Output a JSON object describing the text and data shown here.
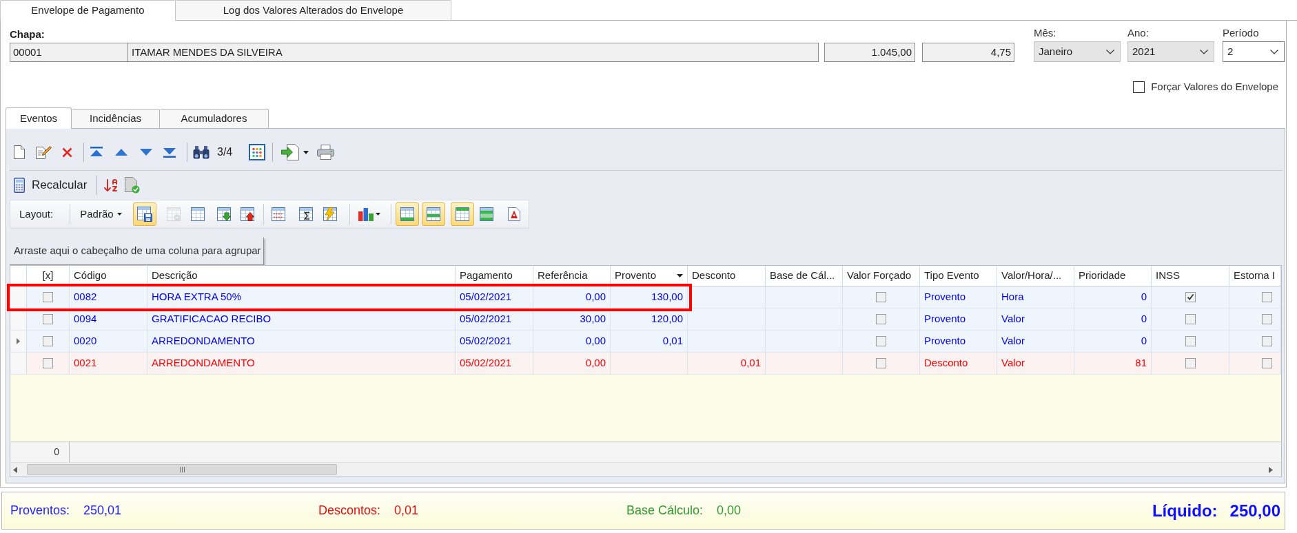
{
  "tabs": [
    {
      "label": "Envelope de Pagamento",
      "selected": true
    },
    {
      "label": "Log dos Valores Alterados do Envelope",
      "selected": false
    }
  ],
  "employee": {
    "label": "Chapa:",
    "chapa": "00001",
    "name": "ITAMAR MENDES DA SILVEIRA",
    "field_3": "1.045,00",
    "field_4": "4,75"
  },
  "selectors": [
    {
      "label": "Mês:",
      "value": "Janeiro",
      "editable": false
    },
    {
      "label": "Ano:",
      "value": "2021",
      "editable": false
    },
    {
      "label": "Período",
      "value": "2",
      "editable": true
    }
  ],
  "force_values": {
    "label": "Forçar Valores do Envelope",
    "checked": false
  },
  "detail_tabs": [
    {
      "label": "Eventos",
      "selected": true
    },
    {
      "label": "Incidências",
      "selected": false
    },
    {
      "label": "Acumuladores",
      "selected": false
    }
  ],
  "navigator": {
    "position": "3/4"
  },
  "actions": {
    "recalculate": "Recalcular"
  },
  "layout_bar": {
    "label": "Layout:",
    "preset": "Padrão",
    "tools": [
      {
        "active": true,
        "disabled": false
      },
      {
        "active": false,
        "disabled": true
      },
      {
        "active": false,
        "disabled": false
      },
      {
        "active": false,
        "disabled": false
      },
      {
        "active": false,
        "disabled": false
      },
      {
        "active": false,
        "disabled": false
      },
      {
        "active": false,
        "disabled": false
      },
      {
        "active": false,
        "disabled": false
      },
      {
        "active": false,
        "disabled": false
      },
      {
        "active": true,
        "disabled": false
      },
      {
        "active": true,
        "disabled": false
      },
      {
        "active": true,
        "disabled": false
      },
      {
        "active": false,
        "disabled": false
      },
      {
        "active": false,
        "disabled": false
      }
    ]
  },
  "grid": {
    "group_hint": "Arraste aqui o cabeçalho de uma coluna para agrupar",
    "columns": [
      {
        "label": "[x]",
        "kind": "check",
        "sorted": false
      },
      {
        "label": "Código",
        "kind": "text",
        "sorted": false
      },
      {
        "label": "Descrição",
        "kind": "text",
        "sorted": false
      },
      {
        "label": "Pagamento",
        "kind": "text",
        "sorted": false
      },
      {
        "label": "Referência",
        "kind": "number",
        "sorted": false
      },
      {
        "label": "Provento",
        "kind": "number",
        "sorted": true
      },
      {
        "label": "Desconto",
        "kind": "number",
        "sorted": false
      },
      {
        "label": "Base de Cál...",
        "kind": "number",
        "sorted": false
      },
      {
        "label": "Valor Forçado",
        "kind": "check",
        "sorted": false
      },
      {
        "label": "Tipo Evento",
        "kind": "text",
        "sorted": false
      },
      {
        "label": "Valor/Hora/...",
        "kind": "text",
        "sorted": false
      },
      {
        "label": "Prioridade",
        "kind": "number",
        "sorted": false
      },
      {
        "label": "INSS",
        "kind": "check",
        "sorted": false
      },
      {
        "label": "Estorna I",
        "kind": "check",
        "sorted": false
      }
    ],
    "rows": [
      {
        "kind": "provento",
        "current": false,
        "highlighted": true,
        "cells": [
          false,
          "0082",
          "HORA EXTRA 50%",
          "05/02/2021",
          "0,00",
          "130,00",
          null,
          null,
          false,
          "Provento",
          "Hora",
          "0",
          true,
          false
        ]
      },
      {
        "kind": "provento",
        "current": false,
        "highlighted": false,
        "cells": [
          false,
          "0094",
          "GRATIFICACAO RECIBO",
          "05/02/2021",
          "30,00",
          "120,00",
          null,
          null,
          false,
          "Provento",
          "Valor",
          "0",
          false,
          false
        ]
      },
      {
        "kind": "provento",
        "current": true,
        "highlighted": false,
        "cells": [
          false,
          "0020",
          "ARREDONDAMENTO",
          "05/02/2021",
          "0,00",
          "0,01",
          null,
          null,
          false,
          "Provento",
          "Valor",
          "0",
          false,
          false
        ]
      },
      {
        "kind": "desconto",
        "current": false,
        "highlighted": false,
        "cells": [
          false,
          "0021",
          "ARREDONDAMENTO",
          "05/02/2021",
          "0,00",
          null,
          "0,01",
          null,
          false,
          "Desconto",
          "Valor",
          "81",
          false,
          false
        ]
      }
    ],
    "footer": "0"
  },
  "totals": [
    {
      "kind": "proventos",
      "label": "Proventos:",
      "value": "250,01"
    },
    {
      "kind": "descontos",
      "label": "Descontos:",
      "value": "0,01"
    },
    {
      "kind": "base",
      "label": "Base Cálculo:",
      "value": "0,00"
    },
    {
      "kind": "liquido",
      "label": "Líquido:",
      "value": "250,00"
    }
  ]
}
